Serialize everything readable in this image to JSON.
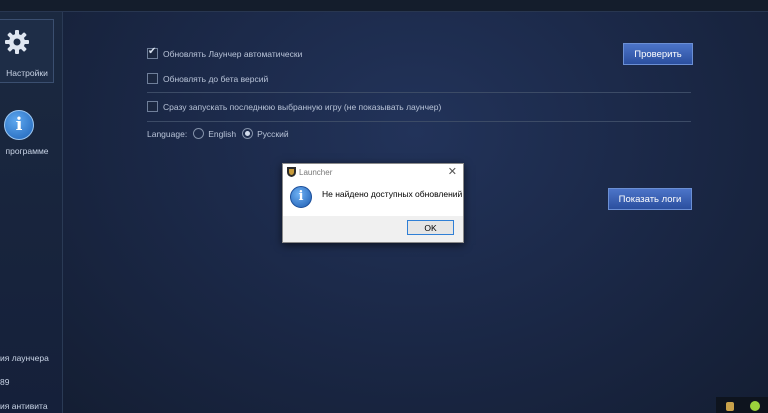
{
  "sidebar": {
    "settings_label": "Настройки",
    "about_label": "программе",
    "bottom": [
      "ия лаунчера",
      "89",
      "ия антивита"
    ]
  },
  "settings": {
    "auto_update_label": "Обновлять Лаунчер автоматически",
    "auto_update_checked": true,
    "beta_label": "Обновлять до бета версий",
    "beta_checked": false,
    "launch_last_label": "Сразу запускать последнюю выбранную игру (не показывать лаунчер)",
    "launch_last_checked": false,
    "language_label": "Language:",
    "language_options": [
      "English",
      "Русский"
    ],
    "language_selected": "Русский"
  },
  "buttons": {
    "check_label": "Проверить",
    "show_logs_label": "Показать логи"
  },
  "dialog": {
    "title": "Launcher",
    "message": "Не найдено доступных обновлений",
    "ok_label": "OK",
    "close_glyph": "✕"
  },
  "colors": {
    "accent": "#3a62b8",
    "background": "#1a2745"
  },
  "icons": {
    "settings": "gear-icon",
    "about": "info-icon",
    "dialog": "information-icon"
  }
}
